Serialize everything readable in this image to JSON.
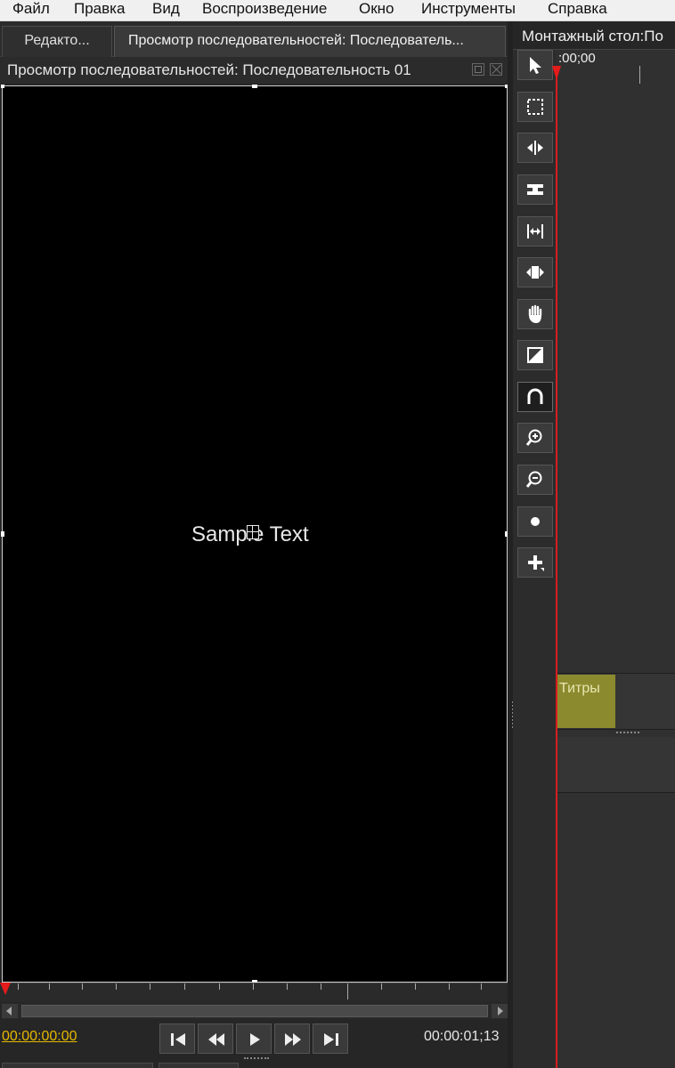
{
  "menu": {
    "items": [
      "Файл",
      "Правка",
      "Вид",
      "Воспроизведение",
      "Окно",
      "Инструменты",
      "Справка"
    ]
  },
  "left_panel": {
    "tabs": [
      {
        "label": "Редакто..."
      },
      {
        "label": "Просмотр последовательностей: Последователь..."
      }
    ],
    "panel_title": "Просмотр последовательностей: Последовательность 01",
    "viewer": {
      "overlay_text": "Sample Text",
      "background": "#000000"
    },
    "transport": {
      "current_timecode": "00:00:00:00",
      "duration_timecode": "00:00:01;13",
      "buttons": [
        {
          "icon": "skip-to-start-icon"
        },
        {
          "icon": "rewind-icon"
        },
        {
          "icon": "play-icon"
        },
        {
          "icon": "fast-forward-icon"
        },
        {
          "icon": "skip-to-end-icon"
        }
      ]
    }
  },
  "right_panel": {
    "title": "Монтажный стол:По",
    "timecode": ":00;00",
    "tools": [
      {
        "icon": "pointer-icon",
        "active": false
      },
      {
        "icon": "marquee-select-icon",
        "active": false
      },
      {
        "icon": "ripple-edit-icon",
        "active": false
      },
      {
        "icon": "rolling-edit-icon",
        "active": false
      },
      {
        "icon": "slip-icon",
        "active": false
      },
      {
        "icon": "slide-icon",
        "active": false
      },
      {
        "icon": "hand-icon",
        "active": false
      },
      {
        "icon": "transition-icon",
        "active": false
      },
      {
        "icon": "snapping-magnet-icon",
        "active": true
      },
      {
        "icon": "zoom-in-icon",
        "active": false
      },
      {
        "icon": "zoom-out-icon",
        "active": false
      },
      {
        "icon": "record-icon",
        "active": false
      },
      {
        "icon": "add-icon",
        "active": false
      }
    ],
    "clip": {
      "label": "Титры",
      "color": "#8c8a2e"
    },
    "playhead_color": "#e31b1b"
  }
}
